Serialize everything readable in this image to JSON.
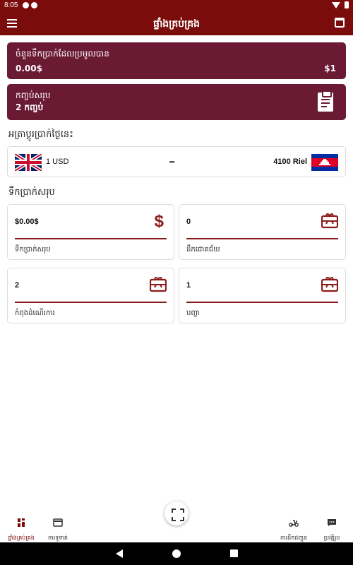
{
  "status_bar": {
    "time": "8:05"
  },
  "app_bar": {
    "title": "ផ្ទាំងគ្រប់គ្រង"
  },
  "summary": {
    "total_collected_label": "ចំនួនទឹកប្រាក់ដែលប្រមូលបាន",
    "total_collected_value": "0.00$",
    "total_collected_right": "$1",
    "packages_label": "កញ្ចប់សរុប",
    "packages_value": "2 កញ្ចប់"
  },
  "exchange": {
    "title": "អត្រាប្តូរប្រាក់ថ្ងៃនេះ",
    "left_value": "1 USD",
    "equals": "=",
    "right_value": "4100 Riel"
  },
  "totals": {
    "title": "ទឹកប្រាក់សរុប",
    "cards": [
      {
        "value": "$0.00$",
        "label": "ទឹកប្រាក់សរុប",
        "icon": "dollar-icon"
      },
      {
        "value": "0",
        "label": "ដឹកជោគជ័យ",
        "icon": "gift-card-icon"
      },
      {
        "value": "2",
        "label": "កំពុងដំណើរការ",
        "icon": "gift-card-icon"
      },
      {
        "value": "1",
        "label": "បញ្ហា",
        "icon": "gift-card-icon"
      }
    ]
  },
  "bottom_nav": [
    {
      "label": "ផ្ទាំងគ្រប់គ្រង",
      "icon": "dashboard-icon",
      "active": true
    },
    {
      "label": "ការទូទាត់",
      "icon": "card-icon",
      "active": false
    },
    {
      "label": "ការដឹកជញ្ជូន",
      "icon": "scooter-icon",
      "active": false
    },
    {
      "label": "ប្រវត្តិរូប",
      "icon": "chat-icon",
      "active": false
    }
  ],
  "colors": {
    "primary": "#7b0c0c",
    "card": "#6b1a34",
    "accent": "#8b1a1a"
  }
}
